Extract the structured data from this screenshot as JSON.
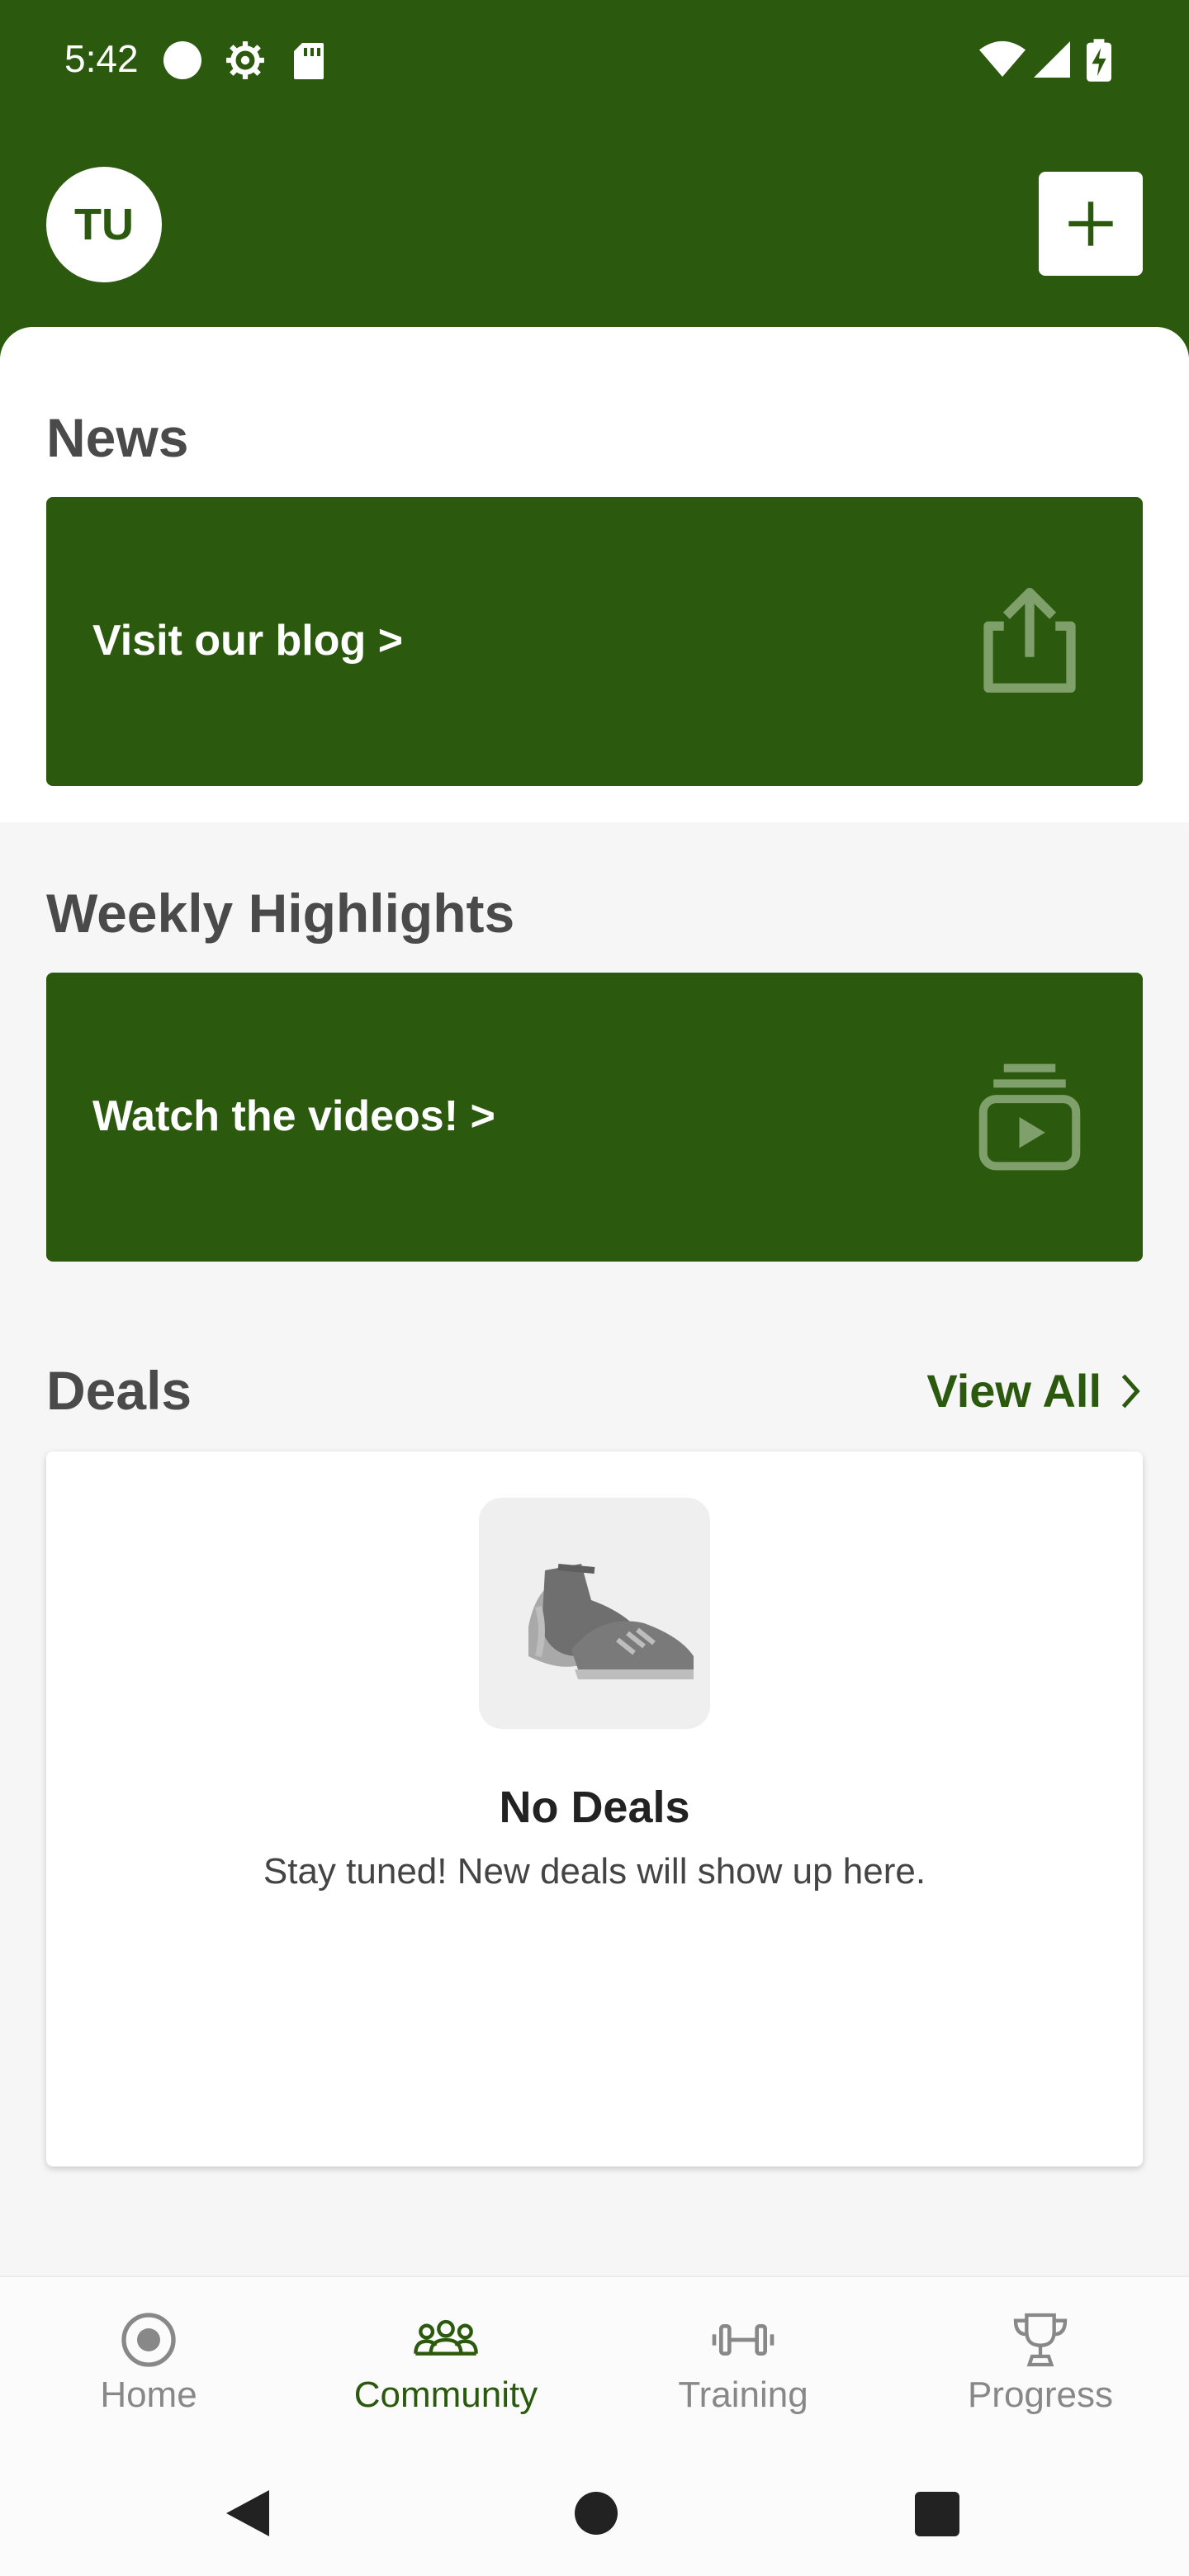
{
  "status_bar": {
    "time": "5:42",
    "icons": [
      "record-icon",
      "gear-icon",
      "sd-card-icon",
      "wifi-icon",
      "signal-icon",
      "battery-charging-icon"
    ]
  },
  "header": {
    "avatar_initials": "TU",
    "add_icon": "plus-icon"
  },
  "news": {
    "title": "News",
    "banner_text": "Visit our blog >",
    "banner_icon": "share-icon"
  },
  "highlights": {
    "title": "Weekly Highlights",
    "banner_text": "Watch the videos! >",
    "banner_icon": "video-library-icon"
  },
  "deals": {
    "title": "Deals",
    "view_all": "View All",
    "empty_title": "No Deals",
    "empty_subtitle": "Stay tuned! New deals will show up here.",
    "empty_icon": "sneakers-icon"
  },
  "nav": {
    "items": [
      {
        "label": "Home",
        "icon": "home-target-icon",
        "active": false
      },
      {
        "label": "Community",
        "icon": "people-icon",
        "active": true
      },
      {
        "label": "Training",
        "icon": "dumbbell-icon",
        "active": false
      },
      {
        "label": "Progress",
        "icon": "trophy-icon",
        "active": false
      }
    ]
  },
  "colors": {
    "brand_green": "#2b5a0e",
    "background": "#f6f6f6",
    "inactive_nav": "#888888"
  }
}
